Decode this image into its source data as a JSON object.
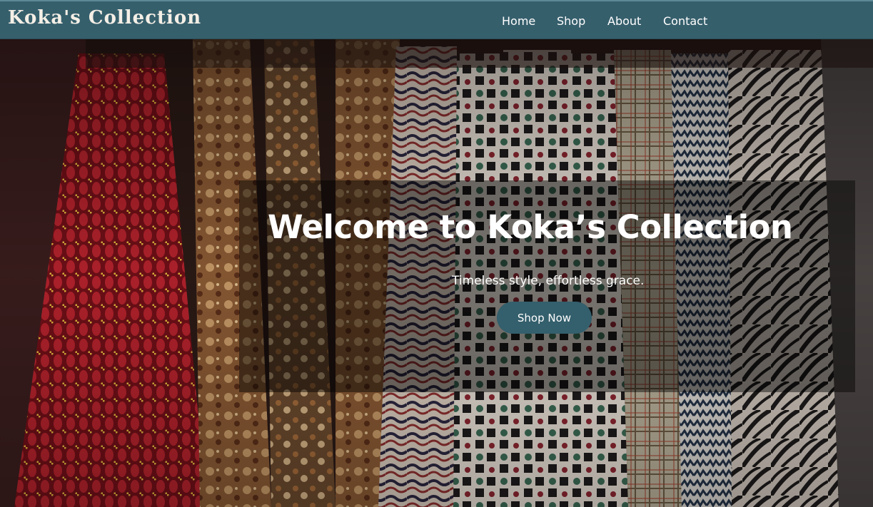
{
  "header": {
    "brand": "Koka's Collection",
    "nav": [
      "Home",
      "Shop",
      "About",
      "Contact"
    ]
  },
  "hero": {
    "title": "Welcome to Koka’s Collection",
    "tagline": "Timeless style, effortless grace.",
    "cta_label": "Shop Now",
    "background_image": "hanging-patterned-shirts-photo"
  },
  "colors": {
    "header_bg": "#365f6c",
    "button_bg": "#345f6c",
    "text": "#ffffff"
  }
}
